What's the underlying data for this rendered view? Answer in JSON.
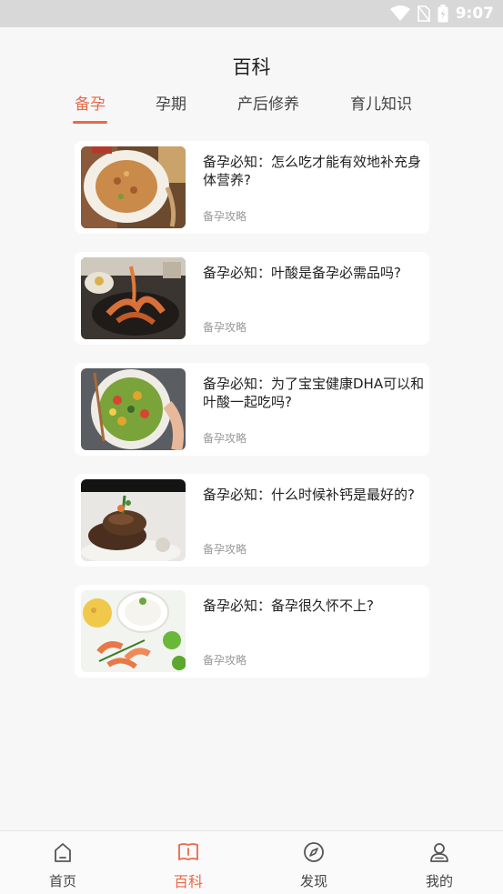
{
  "status_bar": {
    "time": "9:07"
  },
  "header": {
    "title": "百科"
  },
  "tabs": [
    {
      "label": "备孕",
      "active": true
    },
    {
      "label": "孕期",
      "active": false
    },
    {
      "label": "产后修养",
      "active": false
    },
    {
      "label": "育儿知识",
      "active": false
    }
  ],
  "articles": [
    {
      "title": "备孕必知：怎么吃才能有效地补充身体营养?",
      "tag": "备孕攻略"
    },
    {
      "title": "备孕必知：叶酸是备孕必需品吗?",
      "tag": "备孕攻略"
    },
    {
      "title": "备孕必知：为了宝宝健康DHA可以和叶酸一起吃吗?",
      "tag": "备孕攻略"
    },
    {
      "title": "备孕必知：什么时候补钙是最好的?",
      "tag": "备孕攻略"
    },
    {
      "title": "备孕必知：备孕很久怀不上?",
      "tag": "备孕攻略"
    }
  ],
  "bottom_nav": [
    {
      "label": "首页",
      "icon": "home-icon",
      "active": false
    },
    {
      "label": "百科",
      "icon": "book-icon",
      "active": true
    },
    {
      "label": "发现",
      "icon": "compass-icon",
      "active": false
    },
    {
      "label": "我的",
      "icon": "user-icon",
      "active": false
    }
  ],
  "colors": {
    "accent": "#e8694a",
    "background": "#f7f7f7"
  }
}
